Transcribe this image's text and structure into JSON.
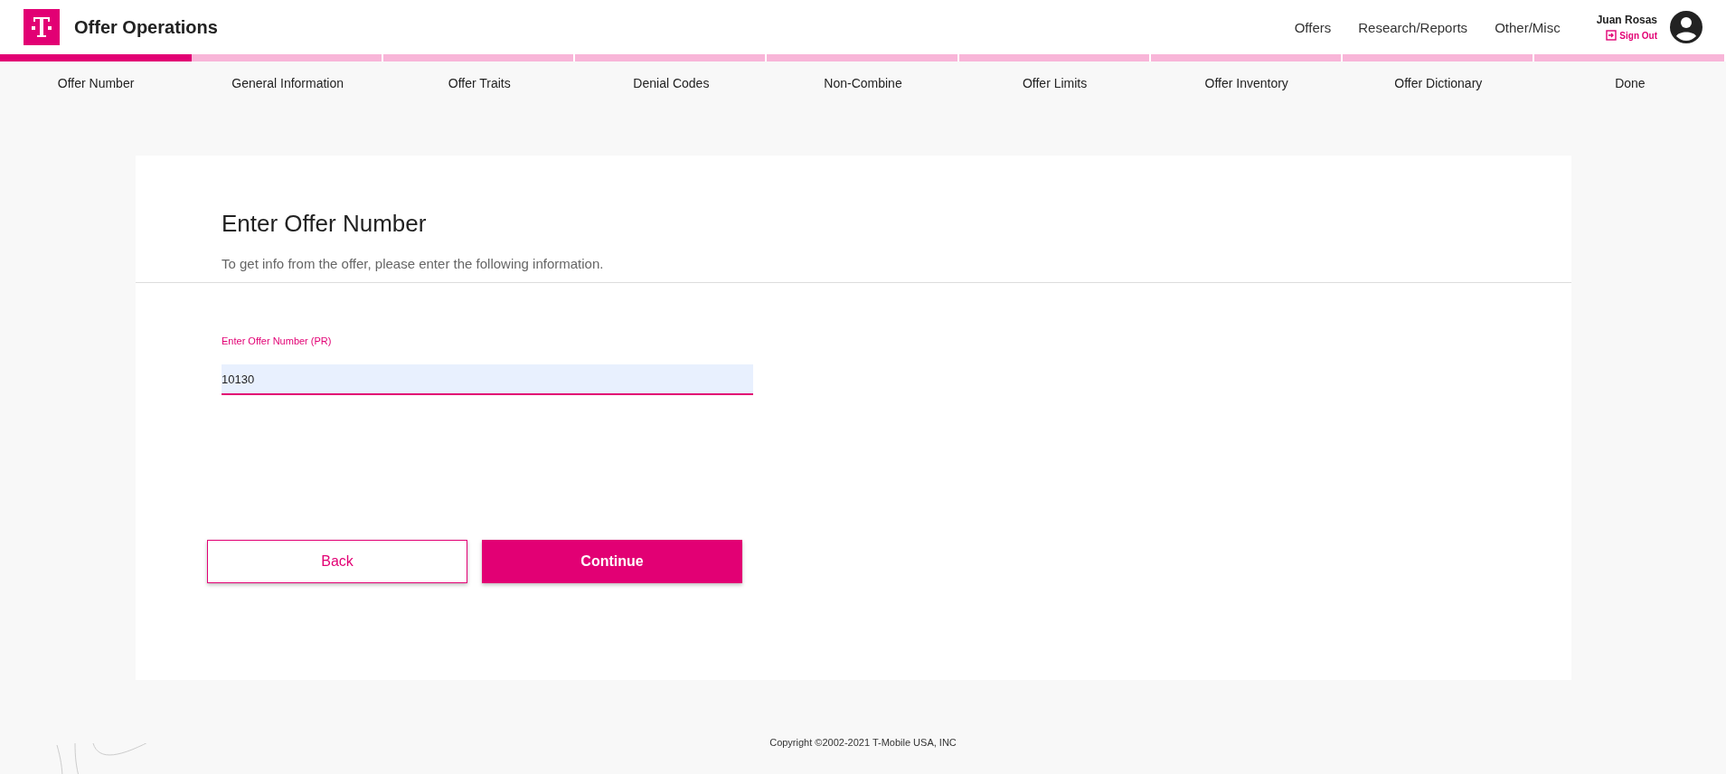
{
  "app": {
    "title": "Offer Operations"
  },
  "nav": [
    "Offers",
    "Research/Reports",
    "Other/Misc"
  ],
  "user": {
    "name": "Juan Rosas",
    "sign_out": "Sign Out"
  },
  "steps": [
    {
      "label": "Offer Number",
      "selected": true
    },
    {
      "label": "General Information",
      "selected": false
    },
    {
      "label": "Offer Traits",
      "selected": false
    },
    {
      "label": "Denial Codes",
      "selected": false
    },
    {
      "label": "Non-Combine",
      "selected": false
    },
    {
      "label": "Offer Limits",
      "selected": false
    },
    {
      "label": "Offer Inventory",
      "selected": false
    },
    {
      "label": "Offer Dictionary",
      "selected": false
    },
    {
      "label": "Done",
      "selected": false
    }
  ],
  "card": {
    "title": "Enter Offer Number",
    "subtitle": "To get info from the offer, please enter the following information.",
    "field": {
      "label": "Enter Offer Number (PR)",
      "value": "10130"
    },
    "buttons": [
      {
        "label": "Back",
        "kind": "secondary"
      },
      {
        "label": "Continue",
        "kind": "primary"
      }
    ]
  },
  "footer": "Copyright ©2002-2021 T-Mobile USA, INC"
}
